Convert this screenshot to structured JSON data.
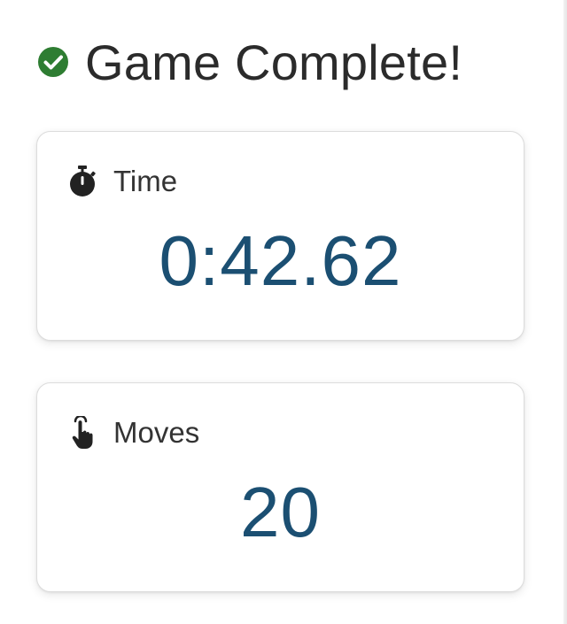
{
  "header": {
    "title": "Game Complete!",
    "icon": "check-circle-icon",
    "icon_color": "#2e7d32"
  },
  "stats": {
    "time": {
      "label": "Time",
      "value": "0:42.62",
      "icon": "stopwatch-icon"
    },
    "moves": {
      "label": "Moves",
      "value": "20",
      "icon": "tap-hand-icon"
    }
  },
  "colors": {
    "value_text": "#1b4f72",
    "label_text": "#333333",
    "title_text": "#2b2b2b"
  }
}
